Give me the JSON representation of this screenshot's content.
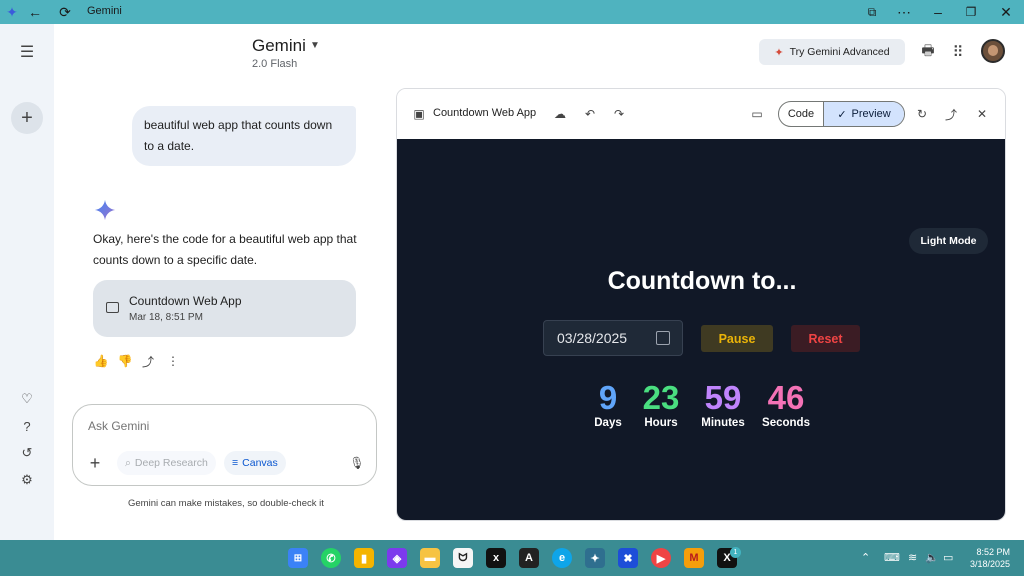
{
  "window": {
    "title": "Gemini"
  },
  "header": {
    "model_name": "Gemini",
    "model_version": "2.0 Flash",
    "advanced_button": "Try Gemini Advanced"
  },
  "chat": {
    "user_message": "beautiful web app that counts down to a date.",
    "assistant_reply": "Okay, here's the code for a beautiful web app that counts down to a specific date.",
    "canvas_card": {
      "title": "Countdown Web App",
      "timestamp": "Mar 18, 8:51 PM"
    }
  },
  "input": {
    "placeholder": "Ask Gemini",
    "chips": {
      "deep_research": "Deep Research",
      "canvas": "Canvas"
    },
    "disclaimer": "Gemini can make mistakes, so double-check it"
  },
  "canvas": {
    "title": "Countdown Web App",
    "segments": {
      "code": "Code",
      "preview": "Preview"
    },
    "preview": {
      "theme_toggle": "Light Mode",
      "heading": "Countdown to...",
      "date_value": "03/28/2025",
      "pause_label": "Pause",
      "reset_label": "Reset",
      "units": [
        {
          "value": "9",
          "label": "Days",
          "color": "#60a5fa"
        },
        {
          "value": "23",
          "label": "Hours",
          "color": "#4ade80"
        },
        {
          "value": "59",
          "label": "Minutes",
          "color": "#c084fc"
        },
        {
          "value": "46",
          "label": "Seconds",
          "color": "#f472b6"
        }
      ]
    }
  },
  "taskbar": {
    "time": "8:52 PM",
    "date": "3/18/2025",
    "notification_count": "1"
  },
  "colors": {
    "titlebar": "#4fb3bf",
    "taskbar": "#3a8c93",
    "preview_bg": "#111827",
    "accent_blue": "#0b57d0"
  }
}
